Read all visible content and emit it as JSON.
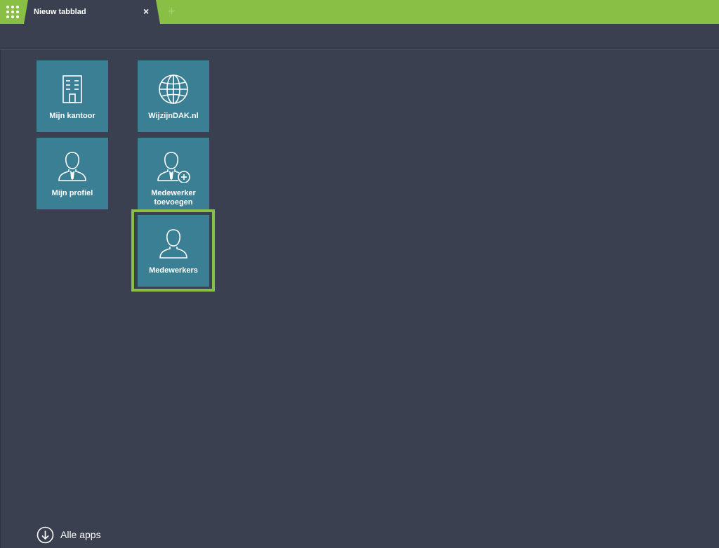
{
  "tabbar": {
    "tab_title": "Nieuw tabblad",
    "close_symbol": "×",
    "new_tab_symbol": "+",
    "accent_color": "#8abf45"
  },
  "tiles": [
    {
      "label": "Mijn kantoor",
      "icon": "office-building-icon"
    },
    {
      "label": "WijzijnDAK.nl",
      "icon": "globe-icon"
    },
    {
      "label": "Mijn profiel",
      "icon": "user-profile-icon"
    },
    {
      "label": "Medewerker toevoegen",
      "icon": "add-user-icon"
    },
    {
      "label": "Medewerkers",
      "icon": "user-icon",
      "selected": true
    }
  ],
  "footer": {
    "all_apps_label": "Alle apps",
    "icon": "arrow-down-circle-icon"
  },
  "colors": {
    "background": "#3b4050",
    "tile": "#3b7f95",
    "highlight": "#8abf45"
  }
}
